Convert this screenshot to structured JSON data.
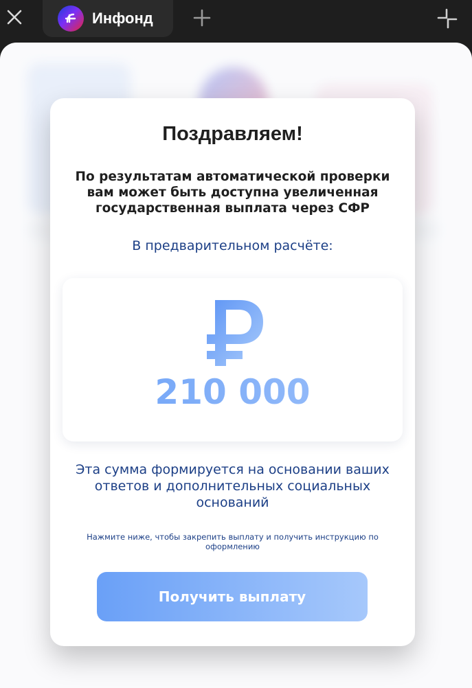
{
  "browser": {
    "tab_title": "Инфонд",
    "accent_colors": {
      "tab_bg": "#2b2b2b",
      "toolbar_bg": "#1e1e1e"
    },
    "icons": {
      "close": "close-icon",
      "new_tab": "plus-icon",
      "collapse": "collapse-icon",
      "logo": "sfr-logo-icon"
    }
  },
  "modal": {
    "title": "Поздравляем!",
    "description": "По результатам автоматической проверки вам может быть доступна увеличенная государственная выплата через СФР",
    "calc_label": "В предварительном расчёте:",
    "amount": "210 000",
    "currency_icon": "ruble-icon",
    "basis_text": "Эта сумма формируется на основании ваших ответов и дополнительных социальных оснований",
    "hint_text": "Нажмите ниже, чтобы закрепить выплату и получить инструкцию по оформлению",
    "cta_label": "Получить выплату",
    "colors": {
      "accent": "#6aa0f7",
      "accent_light": "#a6c8fb",
      "text_dark": "#1f1f1f",
      "text_blue": "#1c3f86"
    }
  }
}
